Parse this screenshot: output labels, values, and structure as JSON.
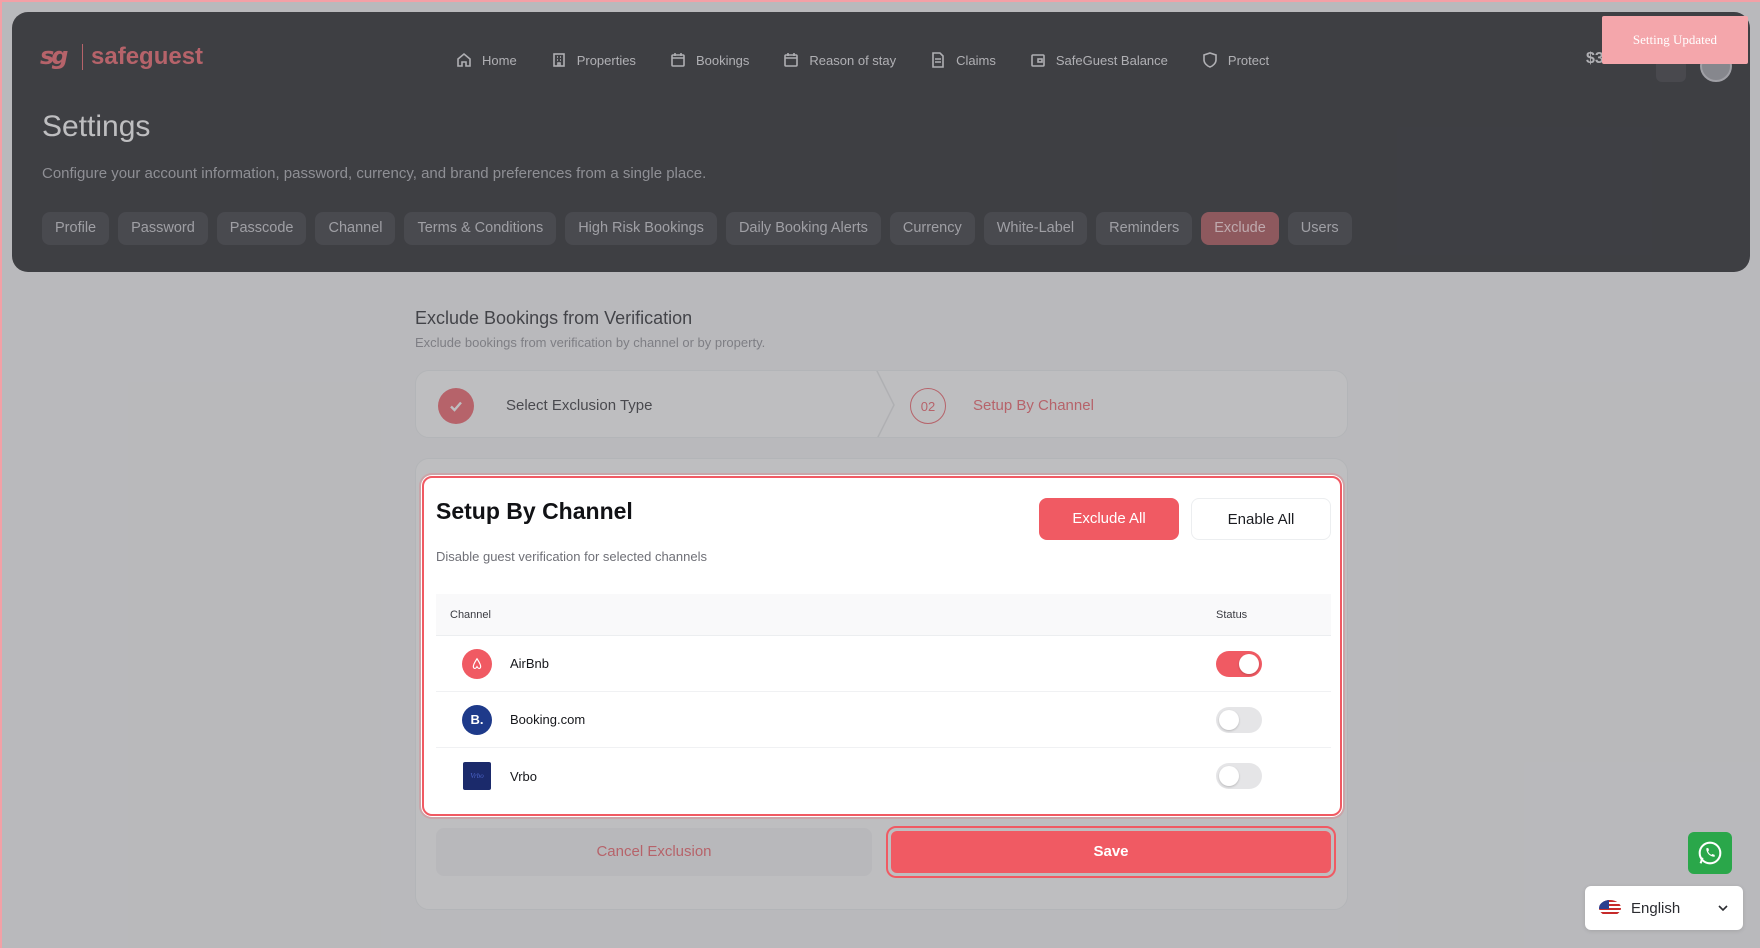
{
  "brand": {
    "name": "safeguest",
    "mark": "sg"
  },
  "topnav": [
    {
      "label": "Home",
      "icon": "home-icon"
    },
    {
      "label": "Properties",
      "icon": "building-icon"
    },
    {
      "label": "Bookings",
      "icon": "calendar-icon"
    },
    {
      "label": "Reason of stay",
      "icon": "calendar-icon"
    },
    {
      "label": "Claims",
      "icon": "document-icon"
    },
    {
      "label": "SafeGuest Balance",
      "icon": "wallet-icon"
    },
    {
      "label": "Protect",
      "icon": "shield-icon"
    }
  ],
  "header": {
    "balance": "$3"
  },
  "toast": {
    "text": "Setting Updated"
  },
  "settings": {
    "title": "Settings",
    "subtitle": "Configure your account information, password, currency, and brand preferences from a single place.",
    "tabs": [
      "Profile",
      "Password",
      "Passcode",
      "Channel",
      "Terms & Conditions",
      "High Risk Bookings",
      "Daily Booking Alerts",
      "Currency",
      "White-Label",
      "Reminders",
      "Exclude",
      "Users"
    ],
    "active_tab": "Exclude"
  },
  "section": {
    "title": "Exclude Bookings from Verification",
    "subtitle": "Exclude bookings from verification by channel or by property."
  },
  "stepper": {
    "step1": {
      "label": "Select Exclusion Type",
      "state": "done"
    },
    "step2": {
      "number": "02",
      "label": "Setup By Channel",
      "state": "active"
    }
  },
  "channel_card": {
    "title": "Setup By Channel",
    "subtitle": "Disable guest verification for selected channels",
    "exclude_all_label": "Exclude All",
    "enable_all_label": "Enable All",
    "columns": {
      "channel": "Channel",
      "status": "Status"
    },
    "rows": [
      {
        "name": "AirBnb",
        "logo": "airbnb",
        "logo_text": "airbnb",
        "enabled": true
      },
      {
        "name": "Booking.com",
        "logo": "booking",
        "logo_text": "B.",
        "enabled": false
      },
      {
        "name": "Vrbo",
        "logo": "vrbo",
        "logo_text": "Vrbo",
        "enabled": false
      }
    ]
  },
  "actions": {
    "cancel_label": "Cancel Exclusion",
    "save_label": "Save"
  },
  "language": {
    "label": "English"
  },
  "colors": {
    "accent": "#f05a63",
    "header_bg": "#17181d",
    "whatsapp": "#2aa74a"
  }
}
